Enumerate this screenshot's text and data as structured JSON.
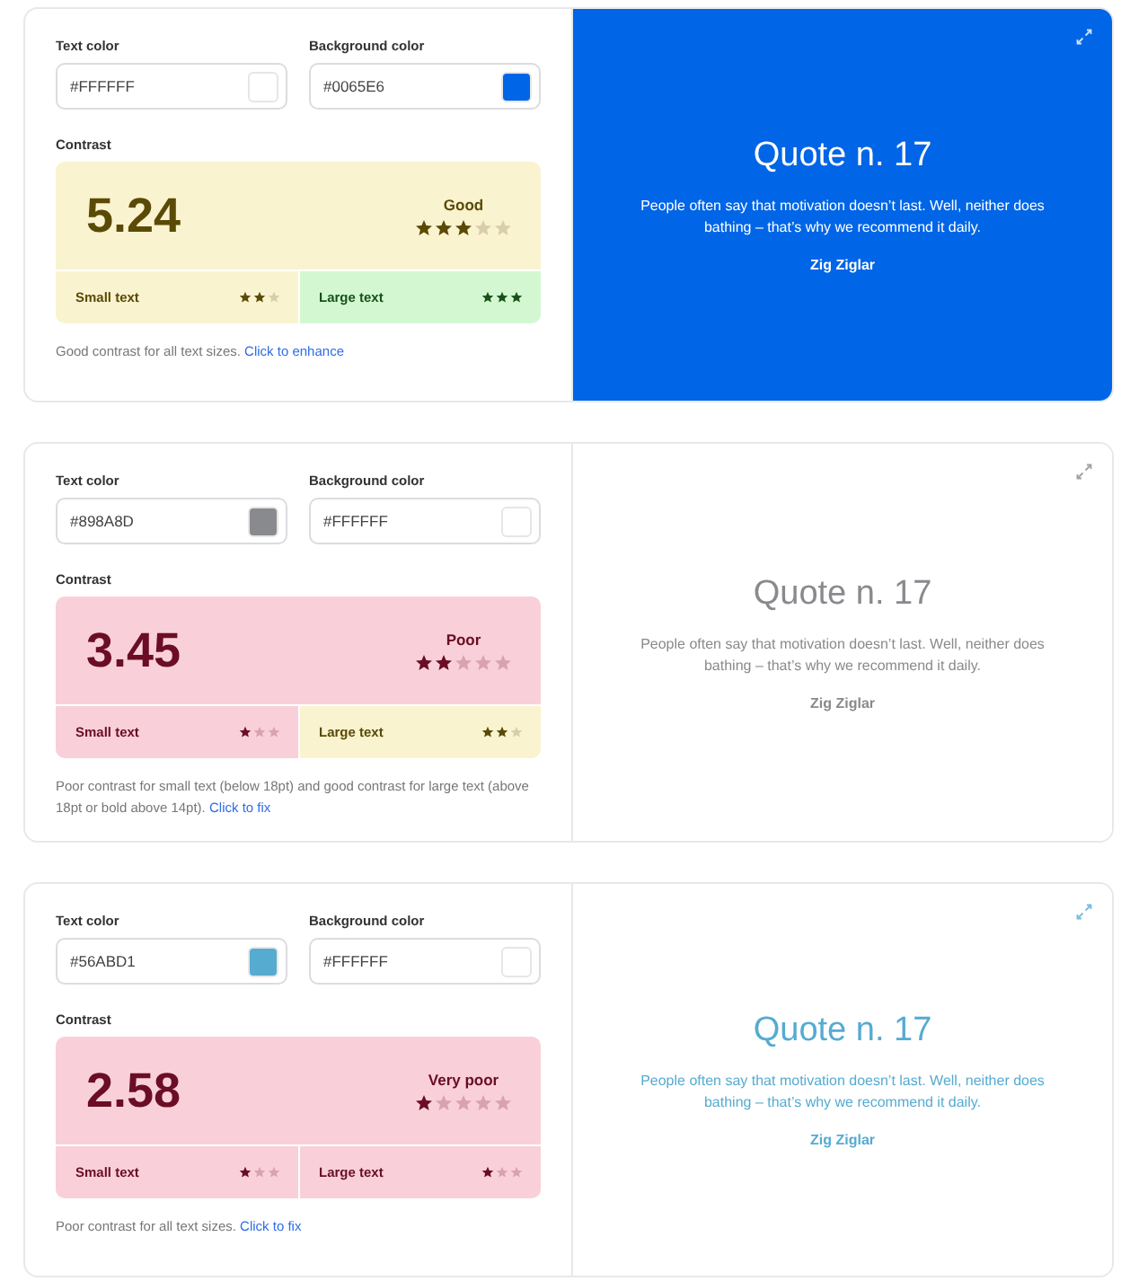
{
  "cards": [
    {
      "text_color": {
        "label": "Text color",
        "value": "#FFFFFF",
        "color": "#ffffff"
      },
      "background_color": {
        "label": "Background color",
        "value": "#0065E6",
        "color": "#0065e6"
      },
      "contrast_label": "Contrast",
      "ratio": "5.24",
      "rating": {
        "label": "Good",
        "color": "#faf3d0",
        "stars": 3
      },
      "small_text": {
        "label": "Small text",
        "color": "#faf3d0",
        "stars": 2
      },
      "large_text": {
        "label": "Large text",
        "color": "#d3f8d1",
        "stars": 3
      },
      "note": "Good contrast for all text sizes.",
      "link": "Click to enhance",
      "preview": {
        "title": "Quote n. 17",
        "quote": "People often say that motivation doesn’t last. Well, neither does bathing – that’s why we recommend it daily.",
        "author": "Zig Ziglar"
      }
    },
    {
      "text_color": {
        "label": "Text color",
        "value": "#898A8D",
        "color": "#898a8d"
      },
      "background_color": {
        "label": "Background color",
        "value": "#FFFFFF",
        "color": "#ffffff"
      },
      "contrast_label": "Contrast",
      "ratio": "3.45",
      "rating": {
        "label": "Poor",
        "color": "#f9d0d9",
        "stars": 2
      },
      "small_text": {
        "label": "Small text",
        "color": "#f9d0d9",
        "stars": 1
      },
      "large_text": {
        "label": "Large text",
        "color": "#faf3d0",
        "stars": 2
      },
      "note": "Poor contrast for small text (below 18pt) and good contrast for large text (above 18pt or bold above 14pt).",
      "link": "Click to fix",
      "preview": {
        "title": "Quote n. 17",
        "quote": "People often say that motivation doesn’t last. Well, neither does bathing – that’s why we recommend it daily.",
        "author": "Zig Ziglar"
      }
    },
    {
      "text_color": {
        "label": "Text color",
        "value": "#56ABD1",
        "color": "#56abd1"
      },
      "background_color": {
        "label": "Background color",
        "value": "#FFFFFF",
        "color": "#ffffff"
      },
      "contrast_label": "Contrast",
      "ratio": "2.58",
      "rating": {
        "label": "Very poor",
        "color": "#f9d0d9",
        "stars": 1
      },
      "small_text": {
        "label": "Small text",
        "color": "#f9d0d9",
        "stars": 1
      },
      "large_text": {
        "label": "Large text",
        "color": "#f9d0d9",
        "stars": 1
      },
      "note": "Poor contrast for all text sizes.",
      "link": "Click to fix",
      "preview": {
        "title": "Quote n. 17",
        "quote": "People often say that motivation doesn’t last. Well, neither does bathing – that’s why we recommend it daily.",
        "author": "Zig Ziglar"
      }
    }
  ]
}
